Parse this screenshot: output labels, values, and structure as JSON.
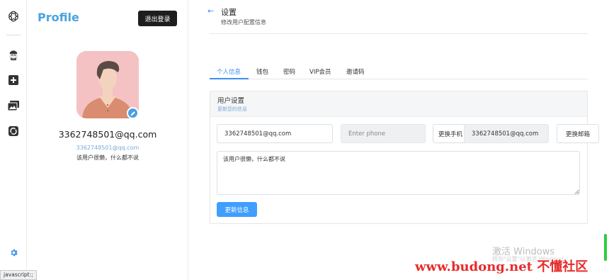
{
  "rail": {
    "icons": [
      "openai-logo-icon",
      "user-avatar-icon",
      "plus-square-icon",
      "images-icon",
      "sync-icon",
      "gear-icon"
    ]
  },
  "profile": {
    "title": "Profile",
    "logout_label": "退出登录",
    "email": "3362748501@qq.com",
    "email_small": "3362748501@qq.com",
    "bio": "该用户很懒，什么都不说"
  },
  "header": {
    "back_icon": "←",
    "title": "设置",
    "subtitle": "修改用户配置信息"
  },
  "tabs": [
    {
      "label": "个人信息",
      "active": true
    },
    {
      "label": "钱包",
      "active": false
    },
    {
      "label": "密码",
      "active": false
    },
    {
      "label": "VIP会员",
      "active": false
    },
    {
      "label": "邀请码",
      "active": false
    }
  ],
  "card": {
    "title": "用户设置",
    "subtitle": "更新您的信息",
    "username_value": "3362748501@qq.com",
    "phone_placeholder": "Enter phone",
    "change_phone_label": "更换手机",
    "email_value": "3362748501@qq.com",
    "change_email_label": "更换邮箱",
    "bio_value": "该用户很懒，什么都不说",
    "update_label": "更新信息"
  },
  "overlay": {
    "windows_activation": "激活 Windows",
    "windows_activation_sub": "转到\"设置\"以激活 Windows。",
    "watermark": "www.budong.net 不懂社区"
  },
  "status_bar": "javascript:;",
  "colors": {
    "accent": "#409eff",
    "profile_title": "#4aa3df",
    "logout_bg": "#1e1e1e",
    "avatar_bg": "#f4c2c2"
  }
}
